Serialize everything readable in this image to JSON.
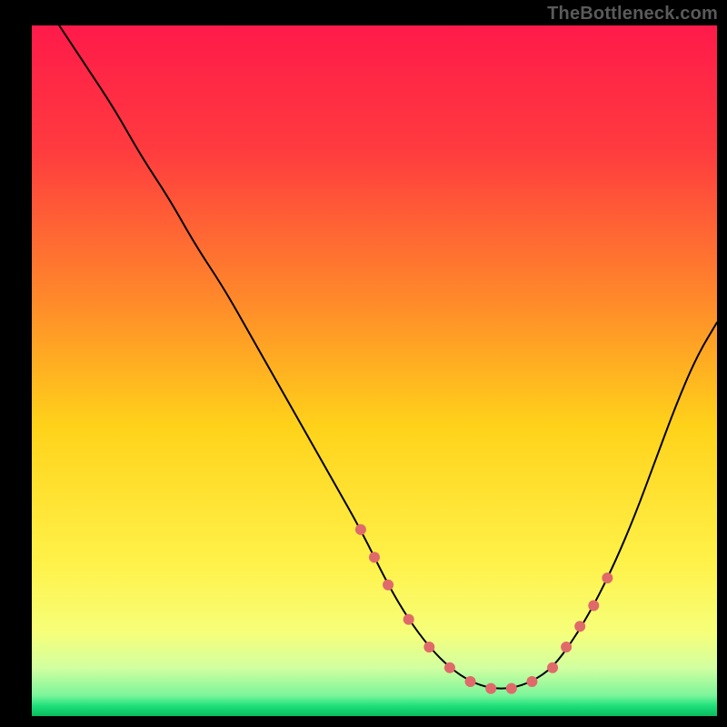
{
  "watermark": "TheBottleneck.com",
  "chart_data": {
    "type": "line",
    "title": "",
    "xlabel": "",
    "ylabel": "",
    "xlim": [
      0,
      100
    ],
    "ylim": [
      0,
      100
    ],
    "background_gradient": {
      "stops": [
        {
          "offset": 0.0,
          "color": "#ff1a4a"
        },
        {
          "offset": 0.18,
          "color": "#ff3b3f"
        },
        {
          "offset": 0.4,
          "color": "#ff8a2a"
        },
        {
          "offset": 0.58,
          "color": "#ffd21a"
        },
        {
          "offset": 0.78,
          "color": "#fff24a"
        },
        {
          "offset": 0.88,
          "color": "#f6ff7a"
        },
        {
          "offset": 0.93,
          "color": "#d2ffa0"
        },
        {
          "offset": 0.97,
          "color": "#7cf59b"
        },
        {
          "offset": 0.985,
          "color": "#1fe07b"
        },
        {
          "offset": 1.0,
          "color": "#08bb5e"
        }
      ]
    },
    "series": [
      {
        "name": "curve",
        "color": "#000000",
        "stroke_width": 2,
        "x": [
          4,
          8,
          12,
          16,
          20,
          24,
          28,
          32,
          36,
          40,
          44,
          48,
          52,
          55,
          58,
          61,
          64,
          67,
          70,
          73,
          76,
          79,
          82,
          85,
          88,
          91,
          94,
          97,
          100
        ],
        "y": [
          100,
          94,
          88,
          81,
          75,
          68,
          62,
          55,
          48,
          41,
          34,
          27,
          19,
          14,
          10,
          7,
          5,
          4,
          4,
          5,
          7,
          11,
          16,
          22,
          29,
          37,
          45,
          52,
          57
        ]
      }
    ],
    "markers": {
      "name": "dots",
      "color": "#e06a6a",
      "radius": 6,
      "x": [
        48,
        50,
        52,
        55,
        58,
        61,
        64,
        67,
        70,
        73,
        76,
        78,
        80,
        82,
        84
      ],
      "y": [
        27,
        23,
        19,
        14,
        10,
        7,
        5,
        4,
        4,
        5,
        7,
        10,
        13,
        16,
        20
      ]
    }
  }
}
